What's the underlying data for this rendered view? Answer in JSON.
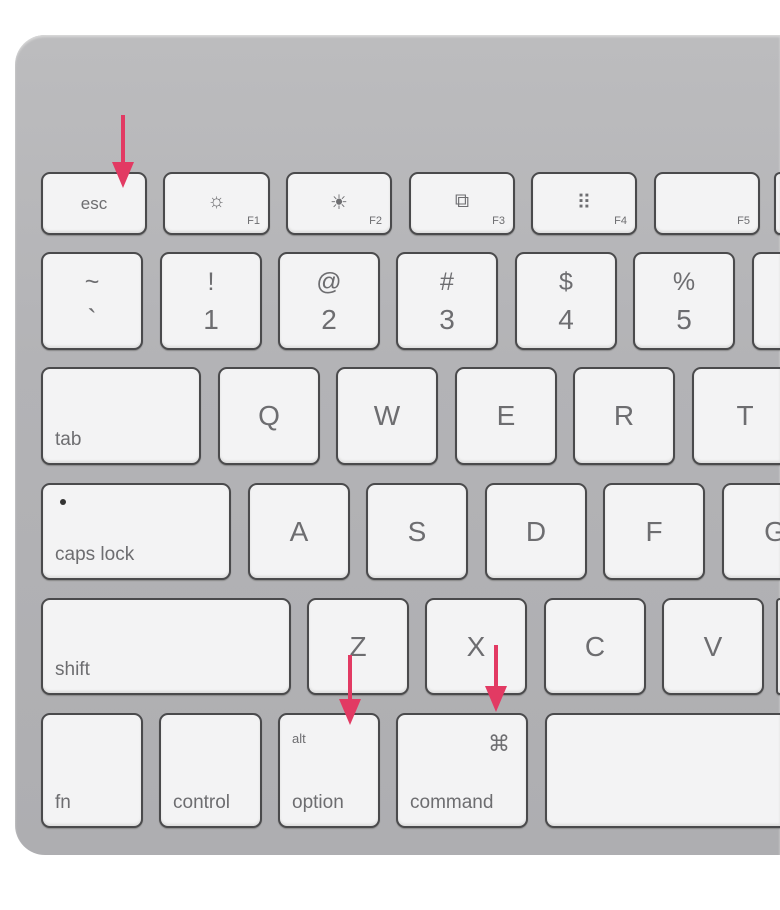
{
  "accent_color": "#e23a63",
  "rows": [
    [
      {
        "label": "esc",
        "type": "word"
      },
      {
        "icon": "brightness-down-icon",
        "glyph": "☼",
        "fn": "F1"
      },
      {
        "icon": "brightness-up-icon",
        "glyph": "☀",
        "fn": "F2"
      },
      {
        "icon": "mission-control-icon",
        "glyph": "⧉",
        "fn": "F3"
      },
      {
        "icon": "dashboard-icon",
        "glyph": "⠿",
        "fn": "F4"
      },
      {
        "fn": "F5"
      },
      {}
    ],
    [
      {
        "top": "~",
        "bottom": "`"
      },
      {
        "top": "!",
        "bottom": "1"
      },
      {
        "top": "@",
        "bottom": "2"
      },
      {
        "top": "#",
        "bottom": "3"
      },
      {
        "top": "$",
        "bottom": "4"
      },
      {
        "top": "%",
        "bottom": "5"
      },
      {}
    ],
    [
      {
        "label": "tab",
        "type": "word"
      },
      {
        "label": "Q"
      },
      {
        "label": "W"
      },
      {
        "label": "E"
      },
      {
        "label": "R"
      },
      {
        "label": "T"
      }
    ],
    [
      {
        "label": "caps lock",
        "type": "word",
        "dot": true
      },
      {
        "label": "A"
      },
      {
        "label": "S"
      },
      {
        "label": "D"
      },
      {
        "label": "F"
      },
      {
        "label": "G"
      }
    ],
    [
      {
        "label": "shift",
        "type": "word"
      },
      {
        "label": "Z"
      },
      {
        "label": "X"
      },
      {
        "label": "C"
      },
      {
        "label": "V"
      },
      {}
    ],
    [
      {
        "label": "fn",
        "type": "word"
      },
      {
        "label": "control",
        "type": "word"
      },
      {
        "label": "option",
        "type": "word",
        "top": "alt"
      },
      {
        "label": "command",
        "type": "word",
        "symbol": "⌘"
      },
      {}
    ]
  ],
  "arrows": [
    "esc",
    "option",
    "command"
  ]
}
